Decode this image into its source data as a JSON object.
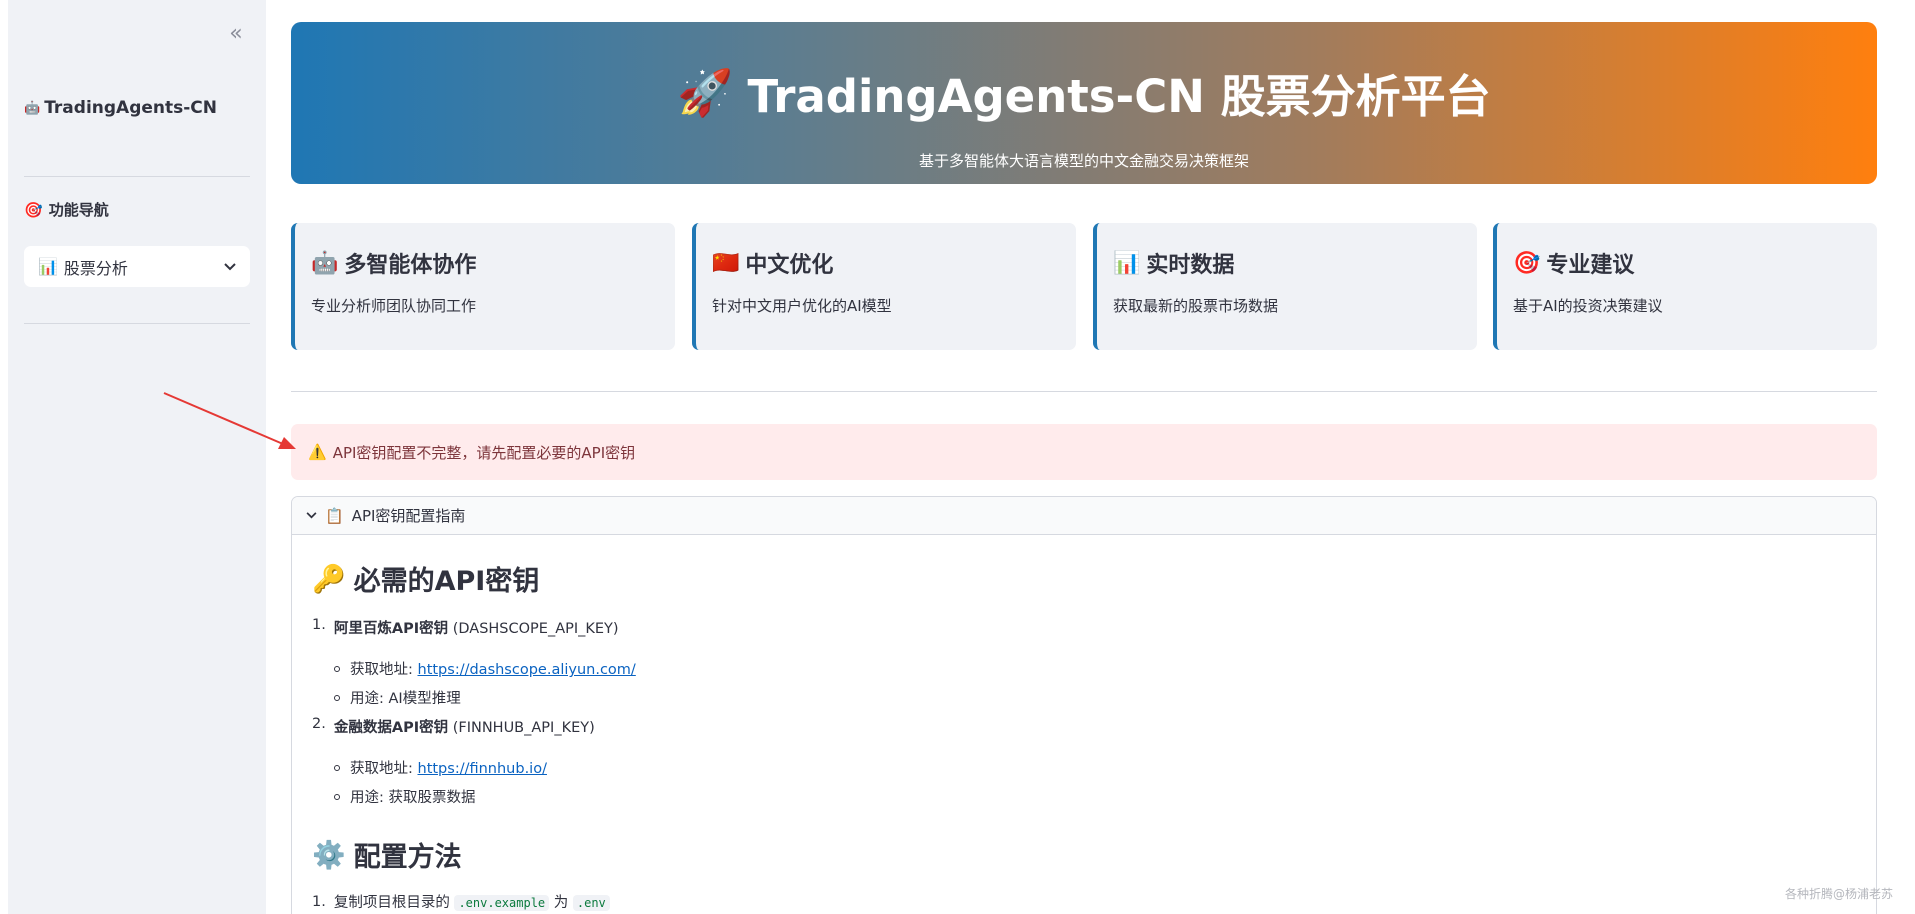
{
  "sidebar": {
    "collapse_icon": "«",
    "brand": {
      "emoji": "🤖",
      "label": "TradingAgents-CN"
    },
    "nav_title": {
      "emoji": "🎯",
      "label": "功能导航"
    },
    "nav_select": {
      "emoji": "📊",
      "label": "股票分析"
    }
  },
  "hero": {
    "emoji": "🚀",
    "title": "TradingAgents-CN 股票分析平台",
    "subtitle": "基于多智能体大语言模型的中文金融交易决策框架"
  },
  "cards": [
    {
      "emoji": "🤖",
      "title": "多智能体协作",
      "desc": "专业分析师团队协同工作"
    },
    {
      "emoji": "🇨🇳",
      "title": "中文优化",
      "desc": "针对中文用户优化的AI模型"
    },
    {
      "emoji": "📊",
      "title": "实时数据",
      "desc": "获取最新的股票市场数据"
    },
    {
      "emoji": "🎯",
      "title": "专业建议",
      "desc": "基于AI的投资决策建议"
    }
  ],
  "alert": {
    "emoji": "⚠️",
    "text": "API密钥配置不完整，请先配置必要的API密钥"
  },
  "expander": {
    "emoji": "📋",
    "label": "API密钥配置指南",
    "section1": {
      "emoji": "🔑",
      "title": "必需的API密钥"
    },
    "items": [
      {
        "num": "1.",
        "bold": "阿里百炼API密钥",
        "rest": " (DASHSCOPE_API_KEY)",
        "addr_label": "获取地址: ",
        "addr_link": "https://dashscope.aliyun.com/",
        "usage": "用途: AI模型推理"
      },
      {
        "num": "2.",
        "bold": "金融数据API密钥",
        "rest": " (FINNHUB_API_KEY)",
        "addr_label": "获取地址: ",
        "addr_link": "https://finnhub.io/",
        "usage": "用途: 获取股票数据"
      }
    ],
    "section2": {
      "emoji": "⚙️",
      "title": "配置方法"
    },
    "step1": {
      "num": "1.",
      "text_a": "复制项目根目录的 ",
      "code_a": ".env.example",
      "text_b": " 为 ",
      "code_b": ".env"
    }
  },
  "watermark": "各种折腾@杨浦老苏"
}
